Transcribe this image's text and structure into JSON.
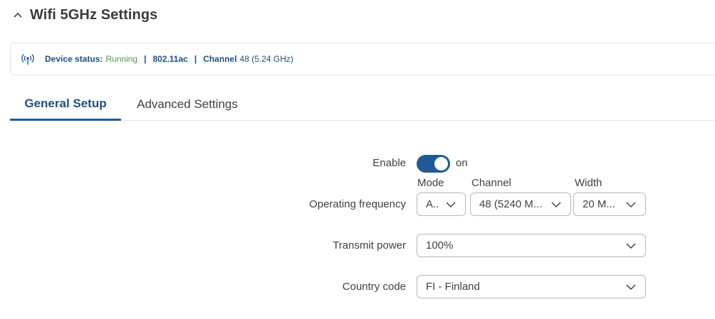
{
  "header": {
    "title": "Wifi 5GHz Settings",
    "collapse_icon": "chevron-up-icon"
  },
  "status": {
    "icon": "wifi-signal-icon",
    "device_label": "Device status:",
    "device_value": "Running",
    "separator": "|",
    "standard": "802.11ac",
    "channel_label": "Channel",
    "channel_value": "48 (5.24 GHz)"
  },
  "tabs": [
    {
      "label": "General Setup",
      "active": true
    },
    {
      "label": "Advanced Settings",
      "active": false
    }
  ],
  "form": {
    "enable": {
      "label": "Enable",
      "state": "on"
    },
    "frequency": {
      "label": "Operating frequency",
      "mode_label": "Mode",
      "mode_value": "A..",
      "channel_label": "Channel",
      "channel_value": "48 (5240 M...",
      "width_label": "Width",
      "width_value": "20 M..."
    },
    "transmit_power": {
      "label": "Transmit power",
      "value": "100%"
    },
    "country_code": {
      "label": "Country code",
      "value": "FI - Finland"
    }
  },
  "colors": {
    "accent": "#1f5a96",
    "running": "#4e9a5a",
    "link": "#1f4f82"
  }
}
